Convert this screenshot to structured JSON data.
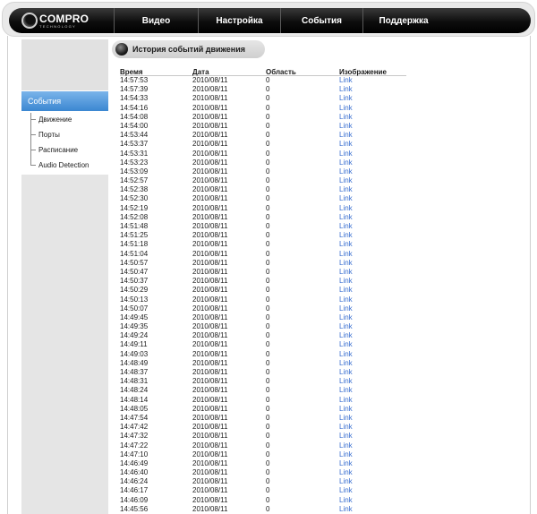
{
  "brand": {
    "name": "COMPRO",
    "tagline": "TECHNOLOGY"
  },
  "nav": {
    "items": [
      "Видео",
      "Настройка",
      "События",
      "Поддержка"
    ]
  },
  "sidebar": {
    "header": "События",
    "items": [
      "Движение",
      "Порты",
      "Расписание",
      "Audio Detection"
    ]
  },
  "main": {
    "title": "История событий движения",
    "columns": [
      "Время",
      "Дата",
      "Область",
      "Изображение"
    ],
    "rows": [
      [
        "14:57:53",
        "2010/08/11",
        "0",
        "Link"
      ],
      [
        "14:57:39",
        "2010/08/11",
        "0",
        "Link"
      ],
      [
        "14:54:33",
        "2010/08/11",
        "0",
        "Link"
      ],
      [
        "14:54:16",
        "2010/08/11",
        "0",
        "Link"
      ],
      [
        "14:54:08",
        "2010/08/11",
        "0",
        "Link"
      ],
      [
        "14:54:00",
        "2010/08/11",
        "0",
        "Link"
      ],
      [
        "14:53:44",
        "2010/08/11",
        "0",
        "Link"
      ],
      [
        "14:53:37",
        "2010/08/11",
        "0",
        "Link"
      ],
      [
        "14:53:31",
        "2010/08/11",
        "0",
        "Link"
      ],
      [
        "14:53:23",
        "2010/08/11",
        "0",
        "Link"
      ],
      [
        "14:53:09",
        "2010/08/11",
        "0",
        "Link"
      ],
      [
        "14:52:57",
        "2010/08/11",
        "0",
        "Link"
      ],
      [
        "14:52:38",
        "2010/08/11",
        "0",
        "Link"
      ],
      [
        "14:52:30",
        "2010/08/11",
        "0",
        "Link"
      ],
      [
        "14:52:19",
        "2010/08/11",
        "0",
        "Link"
      ],
      [
        "14:52:08",
        "2010/08/11",
        "0",
        "Link"
      ],
      [
        "14:51:48",
        "2010/08/11",
        "0",
        "Link"
      ],
      [
        "14:51:25",
        "2010/08/11",
        "0",
        "Link"
      ],
      [
        "14:51:18",
        "2010/08/11",
        "0",
        "Link"
      ],
      [
        "14:51:04",
        "2010/08/11",
        "0",
        "Link"
      ],
      [
        "14:50:57",
        "2010/08/11",
        "0",
        "Link"
      ],
      [
        "14:50:47",
        "2010/08/11",
        "0",
        "Link"
      ],
      [
        "14:50:37",
        "2010/08/11",
        "0",
        "Link"
      ],
      [
        "14:50:29",
        "2010/08/11",
        "0",
        "Link"
      ],
      [
        "14:50:13",
        "2010/08/11",
        "0",
        "Link"
      ],
      [
        "14:50:07",
        "2010/08/11",
        "0",
        "Link"
      ],
      [
        "14:49:45",
        "2010/08/11",
        "0",
        "Link"
      ],
      [
        "14:49:35",
        "2010/08/11",
        "0",
        "Link"
      ],
      [
        "14:49:24",
        "2010/08/11",
        "0",
        "Link"
      ],
      [
        "14:49:11",
        "2010/08/11",
        "0",
        "Link"
      ],
      [
        "14:49:03",
        "2010/08/11",
        "0",
        "Link"
      ],
      [
        "14:48:49",
        "2010/08/11",
        "0",
        "Link"
      ],
      [
        "14:48:37",
        "2010/08/11",
        "0",
        "Link"
      ],
      [
        "14:48:31",
        "2010/08/11",
        "0",
        "Link"
      ],
      [
        "14:48:24",
        "2010/08/11",
        "0",
        "Link"
      ],
      [
        "14:48:14",
        "2010/08/11",
        "0",
        "Link"
      ],
      [
        "14:48:05",
        "2010/08/11",
        "0",
        "Link"
      ],
      [
        "14:47:54",
        "2010/08/11",
        "0",
        "Link"
      ],
      [
        "14:47:42",
        "2010/08/11",
        "0",
        "Link"
      ],
      [
        "14:47:32",
        "2010/08/11",
        "0",
        "Link"
      ],
      [
        "14:47:22",
        "2010/08/11",
        "0",
        "Link"
      ],
      [
        "14:47:10",
        "2010/08/11",
        "0",
        "Link"
      ],
      [
        "14:46:49",
        "2010/08/11",
        "0",
        "Link"
      ],
      [
        "14:46:40",
        "2010/08/11",
        "0",
        "Link"
      ],
      [
        "14:46:24",
        "2010/08/11",
        "0",
        "Link"
      ],
      [
        "14:46:17",
        "2010/08/11",
        "0",
        "Link"
      ],
      [
        "14:46:09",
        "2010/08/11",
        "0",
        "Link"
      ],
      [
        "14:45:56",
        "2010/08/11",
        "0",
        "Link"
      ]
    ]
  },
  "colors": {
    "accent": "#3b87d1",
    "link": "#3a6fd0",
    "navbar": "#0d0d0d"
  }
}
